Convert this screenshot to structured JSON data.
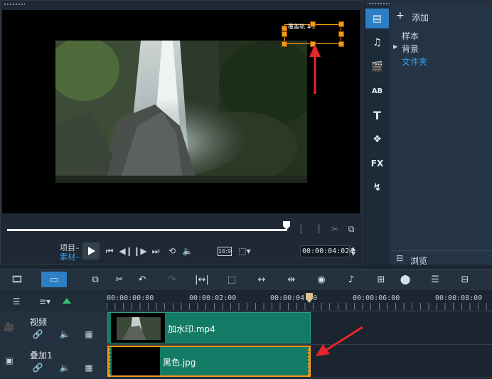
{
  "preview": {
    "overlay_label": "覆盖轨 #1",
    "mode_project": "项目–",
    "mode_clip": "素材–",
    "aspect": "16:9",
    "timecode": "00:00:04:024"
  },
  "library": {
    "add_label": "添加",
    "items": [
      "样本",
      "背景",
      "文件夹"
    ],
    "browse_label": "浏览"
  },
  "timeline": {
    "ruler_ticks": [
      "00:00:00:00",
      "00:00:02:00",
      "00:00:04:00",
      "00:00:06:00",
      "00:00:08:00"
    ],
    "tracks": [
      {
        "name": "视频",
        "clip_label": "加水印.mp4"
      },
      {
        "name": "叠加1",
        "clip_label": "黑色.jpg"
      }
    ]
  },
  "colors": {
    "accent": "#2c7fc4",
    "clip": "#137a65",
    "handle": "#f39a1a",
    "arrow": "#e8262a",
    "selected_text": "#3aa0f0"
  }
}
